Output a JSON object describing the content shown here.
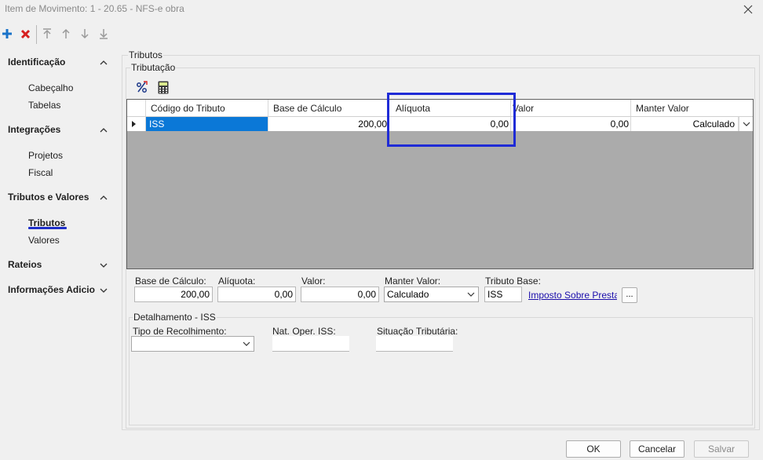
{
  "window": {
    "title": "Item de Movimento: 1 - 20.65 - NFS-e obra"
  },
  "toolbar": {
    "add_icon": "plus-icon",
    "delete_icon": "x-icon",
    "move_first_icon": "arrow-to-top-icon",
    "move_up_icon": "arrow-up-icon",
    "move_down_icon": "arrow-down-icon",
    "move_last_icon": "arrow-to-bottom-icon"
  },
  "sidebar": {
    "sections": [
      {
        "label": "Identificação",
        "expanded": true,
        "items": [
          "Cabeçalho",
          "Tabelas"
        ]
      },
      {
        "label": "Integrações",
        "expanded": true,
        "items": [
          "Projetos",
          "Fiscal"
        ]
      },
      {
        "label": "Tributos e Valores",
        "expanded": true,
        "items": [
          "Tributos",
          "Valores"
        ],
        "active_item": "Tributos"
      },
      {
        "label": "Rateios",
        "expanded": false,
        "items": []
      },
      {
        "label": "Informações Adicio",
        "expanded": false,
        "items": []
      }
    ]
  },
  "main": {
    "group_label": "Tributos",
    "subgroup_label": "Tributação",
    "grid": {
      "columns": [
        "Código do Tributo",
        "Base de Cálculo",
        "Alíquota",
        "Valor",
        "Manter Valor"
      ],
      "rows": [
        {
          "codigo": "ISS",
          "base": "200,00",
          "aliquota": "0,00",
          "valor": "0,00",
          "manter": "Calculado"
        }
      ]
    },
    "fields": {
      "base_label": "Base de Cálculo:",
      "base_value": "200,00",
      "aliquota_label": "Alíquota:",
      "aliquota_value": "0,00",
      "valor_label": "Valor:",
      "valor_value": "0,00",
      "manter_label": "Manter Valor:",
      "manter_value": "Calculado",
      "tributo_base_label": "Tributo Base:",
      "tributo_base_value": "ISS",
      "tributo_base_link": "Imposto Sobre Prestaçã",
      "browse_label": "..."
    },
    "detalhamento": {
      "label": "Detalhamento - ISS",
      "tipo_label": "Tipo de Recolhimento:",
      "tipo_value": "",
      "nat_label": "Nat. Oper. ISS:",
      "nat_value": "",
      "situacao_label": "Situação Tributária:",
      "situacao_value": ""
    }
  },
  "footer": {
    "ok": "OK",
    "cancel": "Cancelar",
    "save": "Salvar"
  },
  "colors": {
    "selection": "#0b78d7",
    "highlight_box": "#1f2bd6",
    "grid_empty": "#ababab",
    "add_icon": "#1a73c9",
    "delete_icon": "#d62020"
  }
}
